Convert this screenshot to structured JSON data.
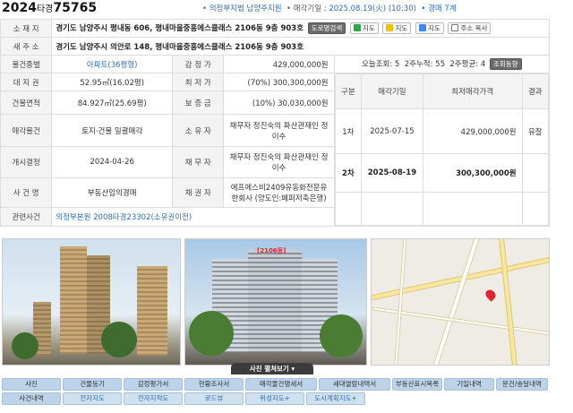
{
  "header": {
    "case_year": "2024",
    "case_type": "타경",
    "case_num": "75765",
    "court": "의정부지법 남양주지원",
    "sale_date_label": "매각기일 :",
    "sale_date": "2025.08.19(火) (10:30)",
    "dept": "경매 7계"
  },
  "info": {
    "address_label": "소 재 지",
    "address": "경기도 남양주시 평내동 606, 평내마을중흥에스클래스 2106동 9층 903호",
    "road_btn": "도로명검색",
    "map_btns": [
      "지도",
      "지도",
      "지도",
      "주소 복사"
    ],
    "new_address_label": "새 주 소",
    "new_address": "경기도 남양주시 의안로 148, 평내마을중흥에스클래스 2106동 9층 903호",
    "type_label": "물건종별",
    "type_value": "아파트(36평형)",
    "appraisal_label": "감 정 가",
    "appraisal_value": "429,000,000원",
    "views_today": "오늘조회: 5",
    "views_2week": "2주누적: 55",
    "views_avg": "2주평균: 4",
    "views_btn": "조회동향",
    "land_label": "대 지 권",
    "land_value": "52.95㎡(16.02평)",
    "min_label": "최 저 가",
    "min_value": "(70%) 300,300,000원",
    "bldg_label": "건물면적",
    "bldg_value": "84.927㎡(25.69평)",
    "deposit_label": "보 증 금",
    "deposit_value": "(10%) 30,030,000원",
    "sale_obj_label": "매각물건",
    "sale_obj_value": "토지·건물 일괄매각",
    "owner_label": "소 유 자",
    "owner_value": "채무자 정진숙의 파산관재인 정이수",
    "start_label": "개시결정",
    "start_value": "2024-04-26",
    "debtor_label": "채 무 자",
    "debtor_value": "채무자 정진숙의 파산관재인 정이수",
    "case_name_label": "사 건 명",
    "case_name_value": "부동산임의경매",
    "creditor_label": "채 권 자",
    "creditor_value": "에프에스비2409유동화전문유한회사 (양도인:페퍼저축은행)",
    "related_label": "관련사건",
    "related_value": "의정부본원 2008타경23302(소유권이전)"
  },
  "rounds": {
    "headers": [
      "구분",
      "매각기일",
      "최저매각가격",
      "결과"
    ],
    "rows": [
      {
        "round": "1차",
        "date": "2025-07-15",
        "price": "429,000,000원",
        "result": "유찰"
      },
      {
        "round": "2차",
        "date": "2025-08-19",
        "price": "300,300,000원",
        "result": ""
      }
    ]
  },
  "photos": {
    "tag": "[2106동]",
    "toggle": "사진 펼쳐보기 ▾"
  },
  "tabs": {
    "row1": [
      "사진",
      "건물등기",
      "감정평가서",
      "현황조사서",
      "매각물건명세서",
      "세대열람내역서",
      "부동산표시목록",
      "기일내역",
      "문건/송달내역"
    ],
    "row2": [
      "사건내역",
      "전자지도",
      "전자지적도",
      "로드뷰",
      "위성지도+",
      "도시계획지도+"
    ]
  }
}
